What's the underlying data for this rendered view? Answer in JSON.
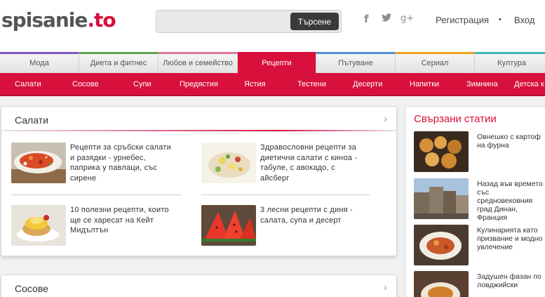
{
  "header": {
    "logo_text": "spisanie",
    "logo_suffix": ".to",
    "search": {
      "placeholder": "",
      "value": "",
      "button_label": "Търсене"
    },
    "social": {
      "facebook": "f",
      "twitter": "🕊",
      "googleplus": "g+"
    },
    "auth": {
      "register": "Регистрация",
      "separator": "•",
      "login": "Вход"
    }
  },
  "categories": [
    {
      "label": "Мода",
      "color": "#7e57c2"
    },
    {
      "label": "Диета и фитнес",
      "color": "#5aa44a"
    },
    {
      "label": "Любов и семейство",
      "color": "#e07ba0"
    },
    {
      "label": "Рецепти",
      "color": "#d7103c"
    },
    {
      "label": "Пътуване",
      "color": "#4f8fd8"
    },
    {
      "label": "Сериал",
      "color": "#f0a020"
    },
    {
      "label": "Култура",
      "color": "#3cb8b0"
    }
  ],
  "subnav": [
    "Салати",
    "Сосове",
    "Супи",
    "Предястия",
    "Ястия",
    "Тестени",
    "Десерти",
    "Напитки",
    "Зимнина",
    "Детска к"
  ],
  "main_card": {
    "title": "Салати",
    "chevron": "›",
    "articles": [
      {
        "lines": [
          "Рецепти за сръбски салати",
          "и разядки - урнебес,",
          "паприка у павлаци, със",
          "сирене"
        ],
        "thumb": "salad-serbian-icon"
      },
      {
        "lines": [
          "Здравословни рецепти за",
          "диетични салати с киноа -",
          "табуле, с авокадо, с",
          "айсберг"
        ],
        "thumb": "salad-quinoa-icon"
      },
      {
        "lines": [
          "10 полезни рецепти, които",
          "ще се харесат на Кейт",
          "Мидълтън"
        ],
        "thumb": "eggs-benedict-icon"
      },
      {
        "lines": [
          "3 лесни рецепти с диня -",
          "салата, супа и десерт"
        ],
        "thumb": "watermelon-icon"
      }
    ]
  },
  "second_card": {
    "title": "Сосове",
    "chevron": "›"
  },
  "related": {
    "title": "Свързани статии",
    "items": [
      {
        "lines": [
          "Овнешко с картоф",
          "на фурна"
        ]
      },
      {
        "lines": [
          "Назад във времето",
          "със",
          "средновековния",
          "град Динан,",
          "Франция"
        ]
      },
      {
        "lines": [
          "Кулинарията като",
          "призвание и модно",
          "увлечение"
        ]
      },
      {
        "lines": [
          "Задушен фазан по",
          "ловджийски"
        ]
      }
    ]
  },
  "colors": {
    "accent": "#d7103c"
  }
}
